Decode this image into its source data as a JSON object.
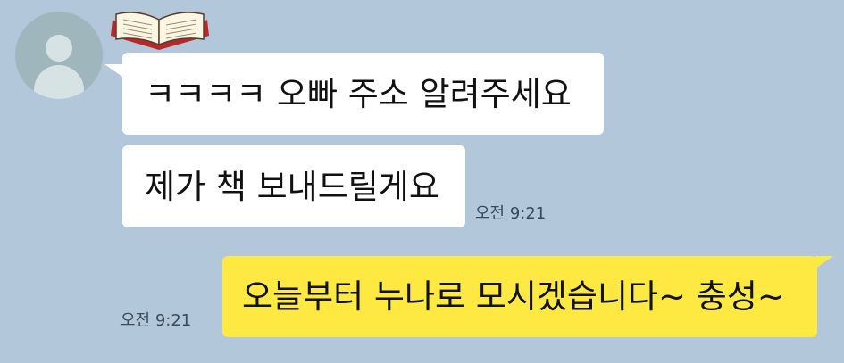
{
  "chat": {
    "received": {
      "avatar_icon": "default-profile-avatar-icon",
      "decoration_icon": "open-book-icon",
      "messages": [
        {
          "text": "ㅋㅋㅋㅋ 오빠 주소 알려주세요"
        },
        {
          "text": "제가 책 보내드릴게요"
        }
      ],
      "time": "오전 9:21"
    },
    "sent": {
      "messages": [
        {
          "text": "오늘부터 누나로 모시겠습니다~ 충성~"
        }
      ],
      "time": "오전 9:21"
    }
  },
  "colors": {
    "background": "#b2c7da",
    "incoming_bubble": "#ffffff",
    "outgoing_bubble": "#fde941",
    "avatar": "#9fb6bd"
  }
}
